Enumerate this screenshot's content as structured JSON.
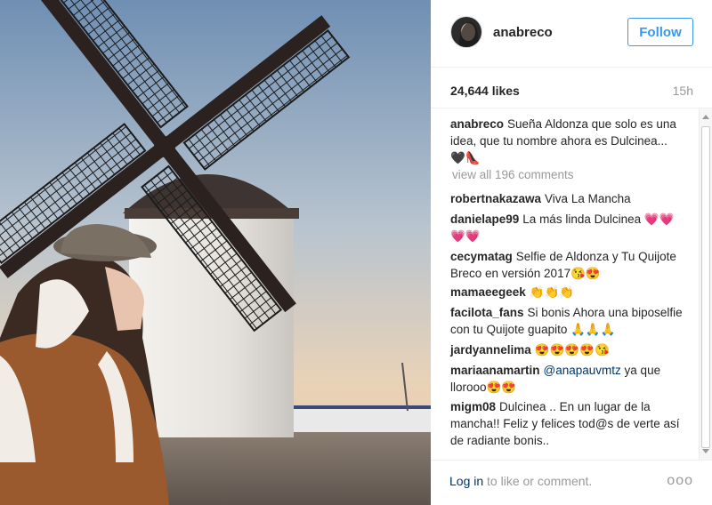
{
  "post": {
    "username": "anabreco",
    "follow_label": "Follow",
    "likes": "24,644 likes",
    "time": "15h",
    "caption": {
      "user": "anabreco",
      "text": "Sueña Aldonza que solo es una idea, que tu nombre ahora es Dulcinea... 🖤👠"
    },
    "view_all": "view all 196 comments",
    "comments": [
      {
        "user": "robertnakazawa",
        "text": "Viva La Mancha"
      },
      {
        "user": "danielape99",
        "text": "La más linda Dulcinea 💗💗💗💗"
      },
      {
        "user": "cecymatag",
        "text": "Selfie de Aldonza y Tu Quijote Breco en versión 2017😘😍"
      },
      {
        "user": "mamaeegeek",
        "text": "👏👏👏"
      },
      {
        "user": "facilota_fans",
        "text": "Si bonis Ahora una biposelfie con tu Quijote guapito 🙏🙏🙏"
      },
      {
        "user": "jardyannelima",
        "text": "😍😍😍😍😘"
      },
      {
        "user": "mariaanamartin",
        "mention": "@anapauvmtz",
        "text": " ya que llorooo😍😍"
      },
      {
        "user": "migm08",
        "text": "Dulcinea .. En un lugar de la mancha!! Feliz y felices tod@s de verte así de radiante bonis.."
      }
    ]
  },
  "footer": {
    "login_link": "Log in",
    "login_rest": " to like or comment.",
    "more_icon": "more-options-icon",
    "more_glyph": "ooo"
  },
  "icons": [
    "avatar",
    "more-options-icon",
    "scroll-up-icon",
    "scroll-down-icon"
  ],
  "colors": {
    "accent": "#3897f0",
    "link": "#003569",
    "muted": "#999999",
    "text": "#262626"
  }
}
